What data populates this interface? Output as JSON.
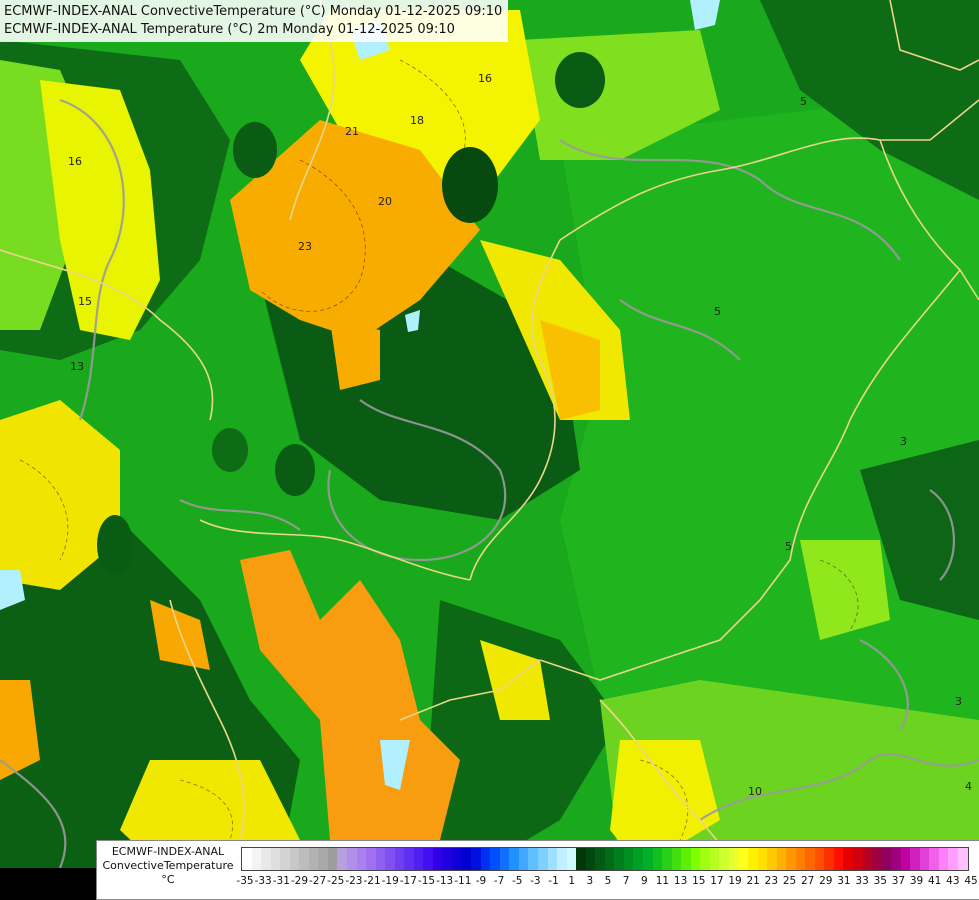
{
  "title_lines": [
    "ECMWF-INDEX-ANAL ConvectiveTemperature (°C) Monday 01-12-2025 09:10",
    "ECMWF-INDEX-ANAL Temperature (°C) 2m Monday 01-12-2025 09:10"
  ],
  "legend": {
    "label_lines": [
      "ECMWF-INDEX-ANAL",
      "ConvectiveTemperature",
      "°C"
    ],
    "tick_labels": [
      "-35",
      "-33",
      "-31",
      "-29",
      "-27",
      "-25",
      "-23",
      "-21",
      "-19",
      "-17",
      "-15",
      "-13",
      "-11",
      "-9",
      "-7",
      "-5",
      "-3",
      "-1",
      "1",
      "3",
      "5",
      "7",
      "9",
      "11",
      "13",
      "15",
      "17",
      "19",
      "21",
      "23",
      "25",
      "27",
      "29",
      "31",
      "33",
      "35",
      "37",
      "39",
      "41",
      "43",
      "45"
    ],
    "colors": [
      "#ffffff",
      "#f4f4f4",
      "#e9e9e9",
      "#dedede",
      "#d3d3d3",
      "#c8c8c8",
      "#bdbdbd",
      "#b2b2b2",
      "#a8a8a8",
      "#9d9d9d",
      "#b8a0e0",
      "#b090e8",
      "#a880f0",
      "#a070f0",
      "#9060f0",
      "#8050f0",
      "#7040f0",
      "#6030f0",
      "#5020f0",
      "#4010f0",
      "#3000e8",
      "#2000e0",
      "#1000d8",
      "#0000d0",
      "#0010e0",
      "#0030f0",
      "#0050ff",
      "#1070ff",
      "#2090ff",
      "#40a8ff",
      "#60c0ff",
      "#80d0ff",
      "#a0e0ff",
      "#c0f0ff",
      "#d0f8ff",
      "#00380a",
      "#004810",
      "#005a14",
      "#006c18",
      "#007e1c",
      "#008e20",
      "#00a024",
      "#00b028",
      "#10c020",
      "#28d018",
      "#40e010",
      "#60f008",
      "#80ff00",
      "#a0ff10",
      "#b8ff20",
      "#d0ff30",
      "#e8ff30",
      "#ffff20",
      "#fff000",
      "#ffe000",
      "#ffc800",
      "#ffb000",
      "#ff9800",
      "#ff8000",
      "#ff6800",
      "#ff5000",
      "#ff3000",
      "#ff1000",
      "#e80000",
      "#d00010",
      "#b80020",
      "#a00040",
      "#900060",
      "#a00080",
      "#c000a0",
      "#d020c0",
      "#e040d8",
      "#f060e8",
      "#ff80f8",
      "#ffa0ff",
      "#ffc0ff"
    ]
  },
  "contour_labels": [
    {
      "text": "16"
    },
    {
      "text": "21"
    },
    {
      "text": "18"
    },
    {
      "text": "20"
    },
    {
      "text": "23"
    },
    {
      "text": "16"
    },
    {
      "text": "15"
    },
    {
      "text": "13"
    },
    {
      "text": "5"
    },
    {
      "text": "5"
    },
    {
      "text": "5"
    },
    {
      "text": "3"
    },
    {
      "text": "3"
    },
    {
      "text": "4"
    },
    {
      "text": "10"
    }
  ],
  "colors": {
    "dark_green": "#0a5c14",
    "mid_green": "#159a1a",
    "bright_green": "#20b818",
    "lime": "#7ee020",
    "yellow": "#f0f000",
    "orange": "#f8a800",
    "light_blue": "#b0f0ff",
    "border": "#ead68a",
    "contour": "#9a9a9a"
  }
}
